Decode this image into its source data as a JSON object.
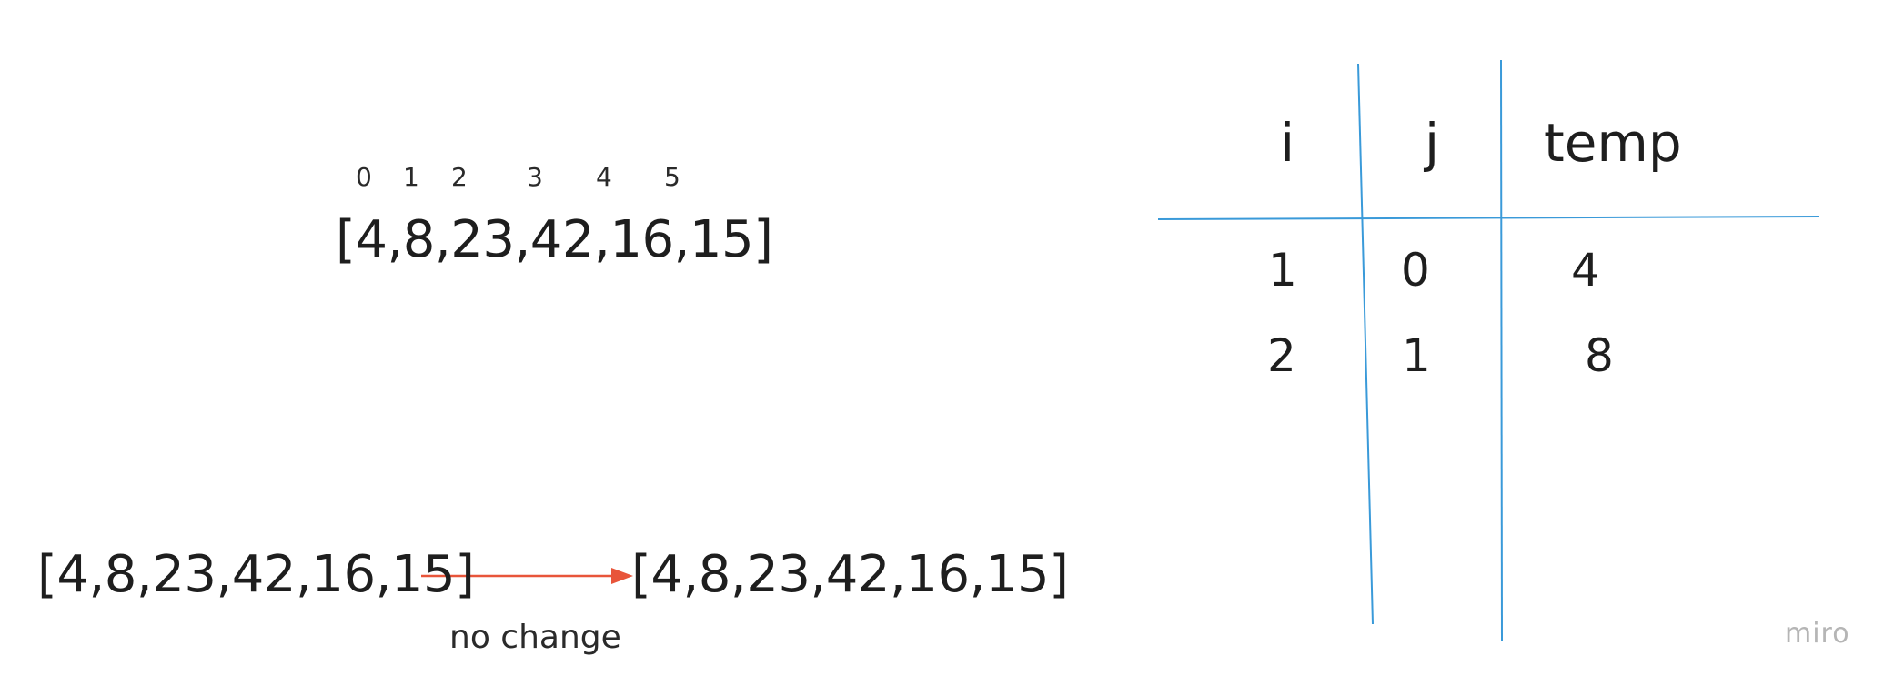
{
  "diagram": {
    "indices": [
      "0",
      "1",
      "2",
      "3",
      "4",
      "5"
    ],
    "array_top": "[4,8,23,42,16,15]",
    "transition": {
      "before": "[4,8,23,42,16,15]",
      "after": "[4,8,23,42,16,15]",
      "label": "no change",
      "arrow_color": "#e8553a"
    }
  },
  "trace_table": {
    "line_color": "#3a9ad9",
    "headers": [
      "i",
      "j",
      "temp"
    ],
    "rows": [
      [
        "1",
        "0",
        "4"
      ],
      [
        "2",
        "1",
        "8"
      ]
    ]
  },
  "watermark": "miro"
}
